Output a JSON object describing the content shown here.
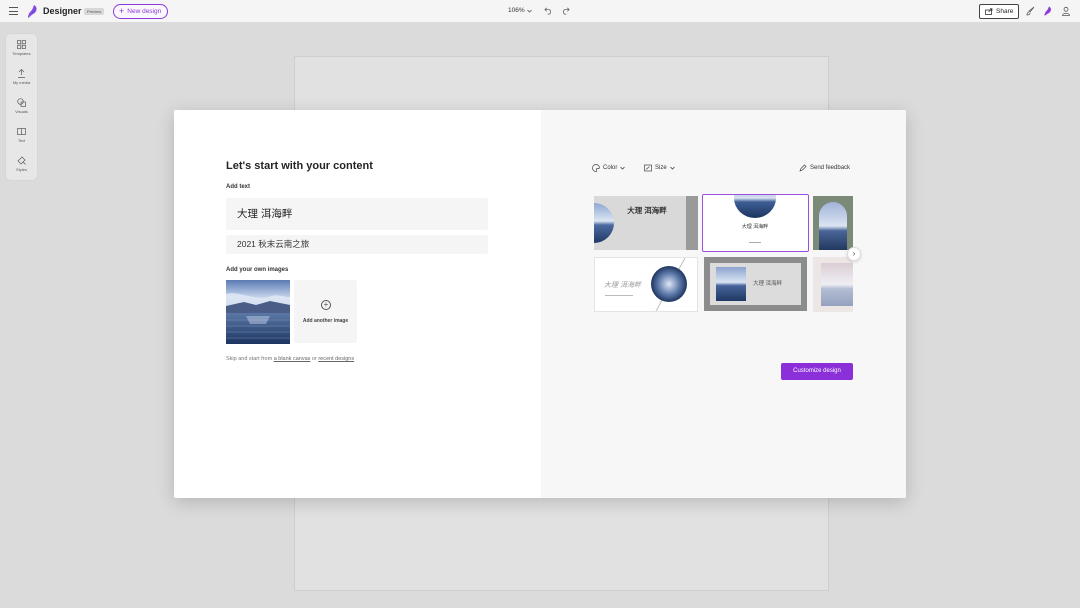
{
  "topbar": {
    "app_title": "Designer",
    "badge": "Preview",
    "new_design_label": "New design",
    "zoom": "106%",
    "share_label": "Share"
  },
  "rail": {
    "items": [
      {
        "label": "Templates",
        "icon": "templates-icon"
      },
      {
        "label": "My media",
        "icon": "my-media-icon"
      },
      {
        "label": "Visuals",
        "icon": "visuals-icon"
      },
      {
        "label": "Text",
        "icon": "text-icon"
      },
      {
        "label": "Styles",
        "icon": "styles-icon"
      }
    ]
  },
  "modal": {
    "heading": "Let's start with your content",
    "add_text_label": "Add text",
    "text_main": "大理 洱海畔",
    "text_sub": "2021 秋末云南之旅",
    "add_images_label": "Add your own images",
    "add_another_label": "Add another image",
    "skip_prefix": "Skip and start from ",
    "blank_canvas_link": "a blank canvas",
    "skip_or": " or ",
    "recent_link": "recent designs",
    "color_label": "Color",
    "size_label": "Size",
    "feedback_label": "Send feedback",
    "customize_label": "Customize design",
    "card_title": "大理 洱海畔",
    "card_sub": "2021 秋末云南之旅"
  },
  "colors": {
    "accent": "#8b2fd8",
    "selected_border": "#9b4fde"
  }
}
